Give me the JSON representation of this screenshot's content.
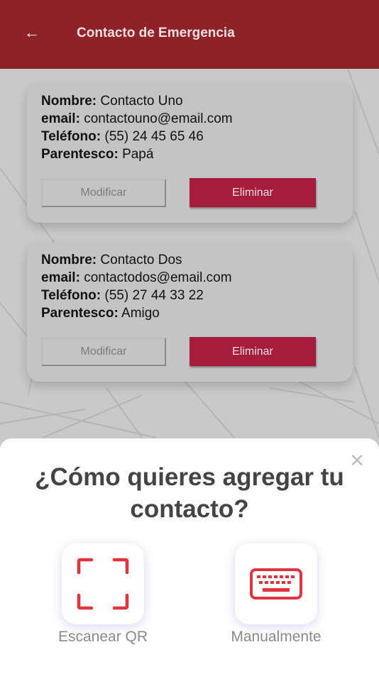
{
  "header": {
    "back_icon": "arrow-left-icon",
    "title": "Contacto de Emergencia"
  },
  "labels": {
    "nombre": "Nombre:",
    "email": "email:",
    "telefono": "Teléfono:",
    "parentesco": "Parentesco:"
  },
  "contacts": [
    {
      "nombre": "Contacto Uno",
      "email": "contactouno@email.com",
      "telefono": "(55) 24 45 65 46",
      "parentesco": "Papá",
      "modify_label": "Modificar",
      "delete_label": "Eliminar"
    },
    {
      "nombre": "Contacto Dos",
      "email": "contactodos@email.com",
      "telefono": "(55) 27 44 33 22",
      "parentesco": "Amigo",
      "modify_label": "Modificar",
      "delete_label": "Eliminar"
    }
  ],
  "sheet": {
    "title": "¿Cómo quieres agregar tu contacto?",
    "close_icon": "close-icon",
    "options": [
      {
        "label": "Escanear QR",
        "icon": "scan-qr-icon"
      },
      {
        "label": "Manualmente",
        "icon": "keyboard-icon"
      }
    ]
  },
  "colors": {
    "header": "#8e2228",
    "delete_button": "#a61c3c",
    "icon_red": "#e2343c",
    "overlay": "#c9c9c9"
  }
}
